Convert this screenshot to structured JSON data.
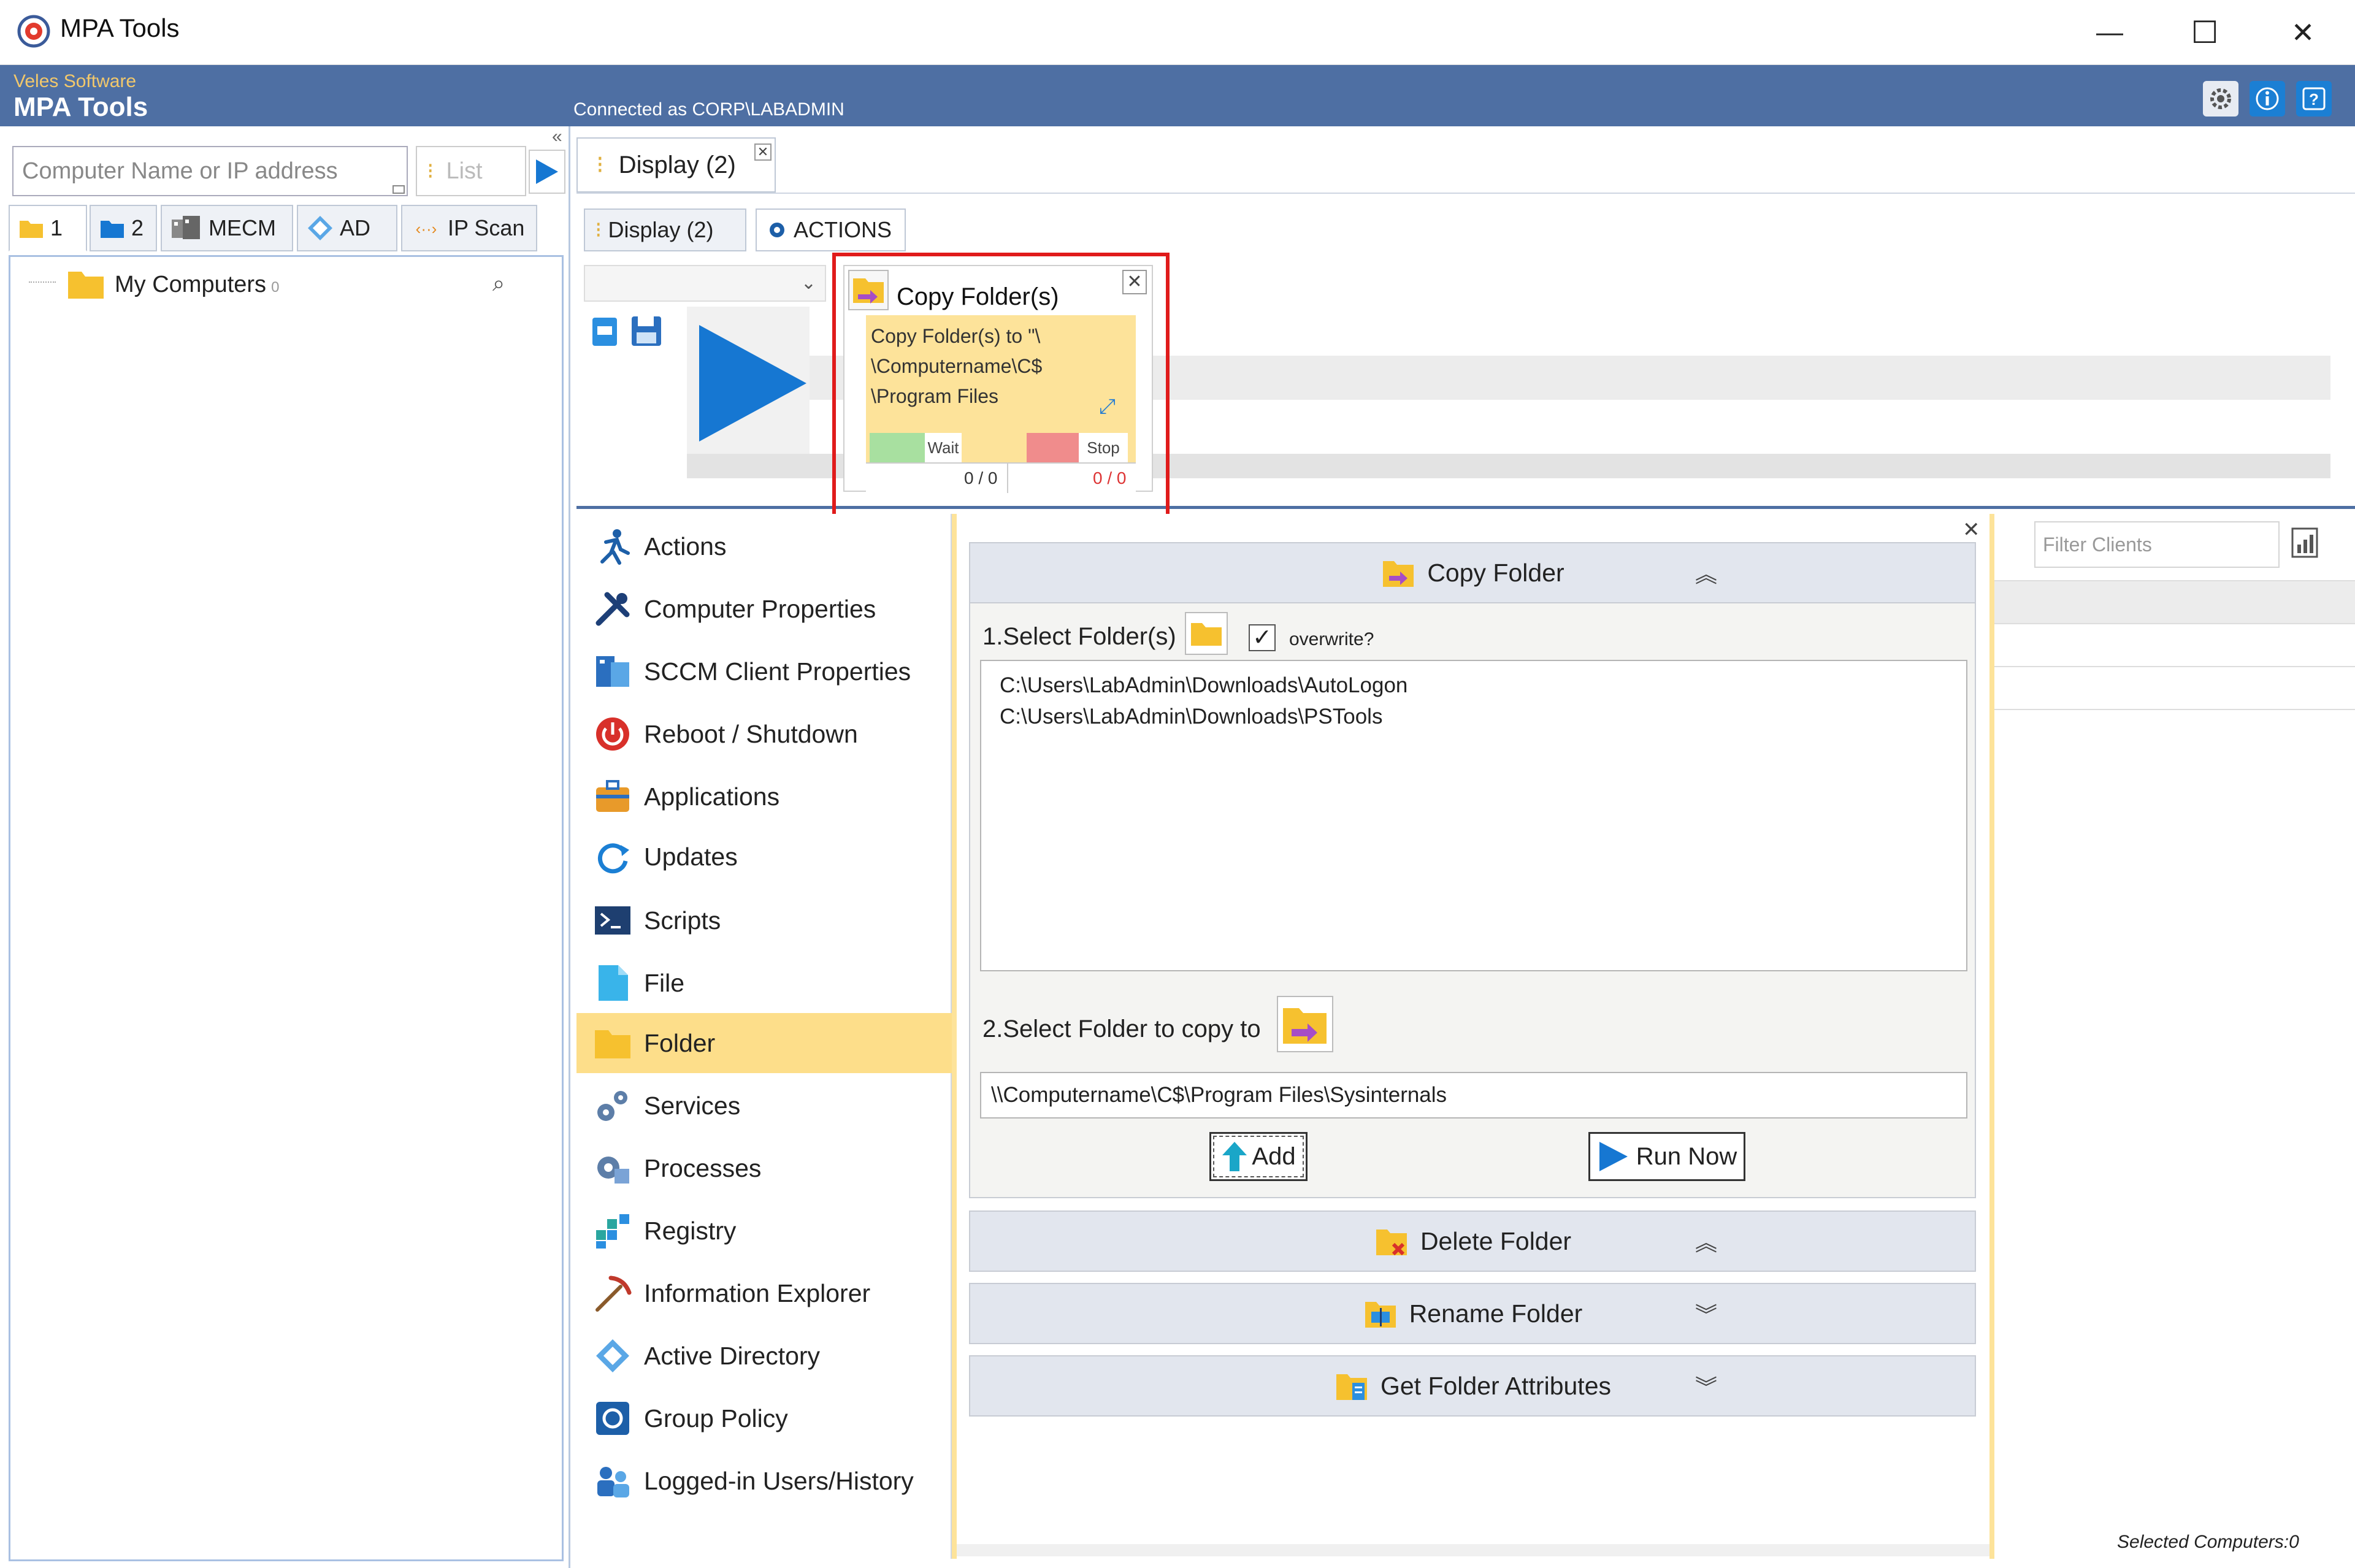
{
  "window": {
    "title": "MPA Tools",
    "controls": {
      "minimize": "—",
      "maximize": "☐",
      "close": "✕"
    }
  },
  "header": {
    "vendor": "Veles Software",
    "product": "MPA Tools",
    "connected": "Connected as CORP\\LABADMIN"
  },
  "left": {
    "search_placeholder": "Computer Name or IP address",
    "list_label": "List",
    "tabs": [
      {
        "label": "1"
      },
      {
        "label": "2"
      },
      {
        "label": "MECM"
      },
      {
        "label": "AD"
      },
      {
        "label": "IP Scan"
      }
    ],
    "tree": {
      "root": "My Computers",
      "count": "0"
    }
  },
  "workspace": {
    "main_tab": "Display (2)",
    "sub_tabs": [
      {
        "label": "Display (2)"
      },
      {
        "label": "ACTIONS"
      }
    ]
  },
  "job": {
    "title": "Copy Folder(s)",
    "description": "Copy Folder(s) to \"\\ \\Computername\\C$ \\Program Files",
    "wait_label": "Wait",
    "stop_label": "Stop",
    "wait_count": "0 / 0",
    "stop_count": "0 / 0"
  },
  "menu": {
    "items": [
      {
        "label": "Actions"
      },
      {
        "label": "Computer Properties"
      },
      {
        "label": "SCCM Client Properties"
      },
      {
        "label": "Reboot / Shutdown"
      },
      {
        "label": "Applications"
      },
      {
        "label": "Updates"
      },
      {
        "label": "Scripts"
      },
      {
        "label": "File"
      },
      {
        "label": "Folder"
      },
      {
        "label": "Services"
      },
      {
        "label": "Processes"
      },
      {
        "label": "Registry"
      },
      {
        "label": "Information Explorer"
      },
      {
        "label": "Active Directory"
      },
      {
        "label": "Group Policy"
      },
      {
        "label": "Logged-in Users/History"
      }
    ],
    "active": "Folder"
  },
  "copy_folder": {
    "title": "Copy Folder",
    "step1": "1.Select Folder(s)",
    "overwrite": "overwrite?",
    "overwrite_checked": true,
    "folders": [
      "C:\\Users\\LabAdmin\\Downloads\\AutoLogon",
      "C:\\Users\\LabAdmin\\Downloads\\PSTools"
    ],
    "step2": "2.Select Folder to copy to",
    "destination": "\\\\Computername\\C$\\Program Files\\Sysinternals",
    "add": "Add",
    "run_now": "Run Now"
  },
  "sections": [
    {
      "label": "Delete Folder",
      "chevron": "︽"
    },
    {
      "label": "Rename Folder",
      "chevron": "︾"
    },
    {
      "label": "Get Folder Attributes",
      "chevron": "︾"
    }
  ],
  "clients": {
    "filter_placeholder": "Filter Clients",
    "selected": "Selected Computers:0"
  },
  "colors": {
    "header_blue": "#4e6fa3",
    "accent_yellow": "#fde39a",
    "highlight_red": "#e01b1b",
    "play_blue": "#1677d2"
  }
}
